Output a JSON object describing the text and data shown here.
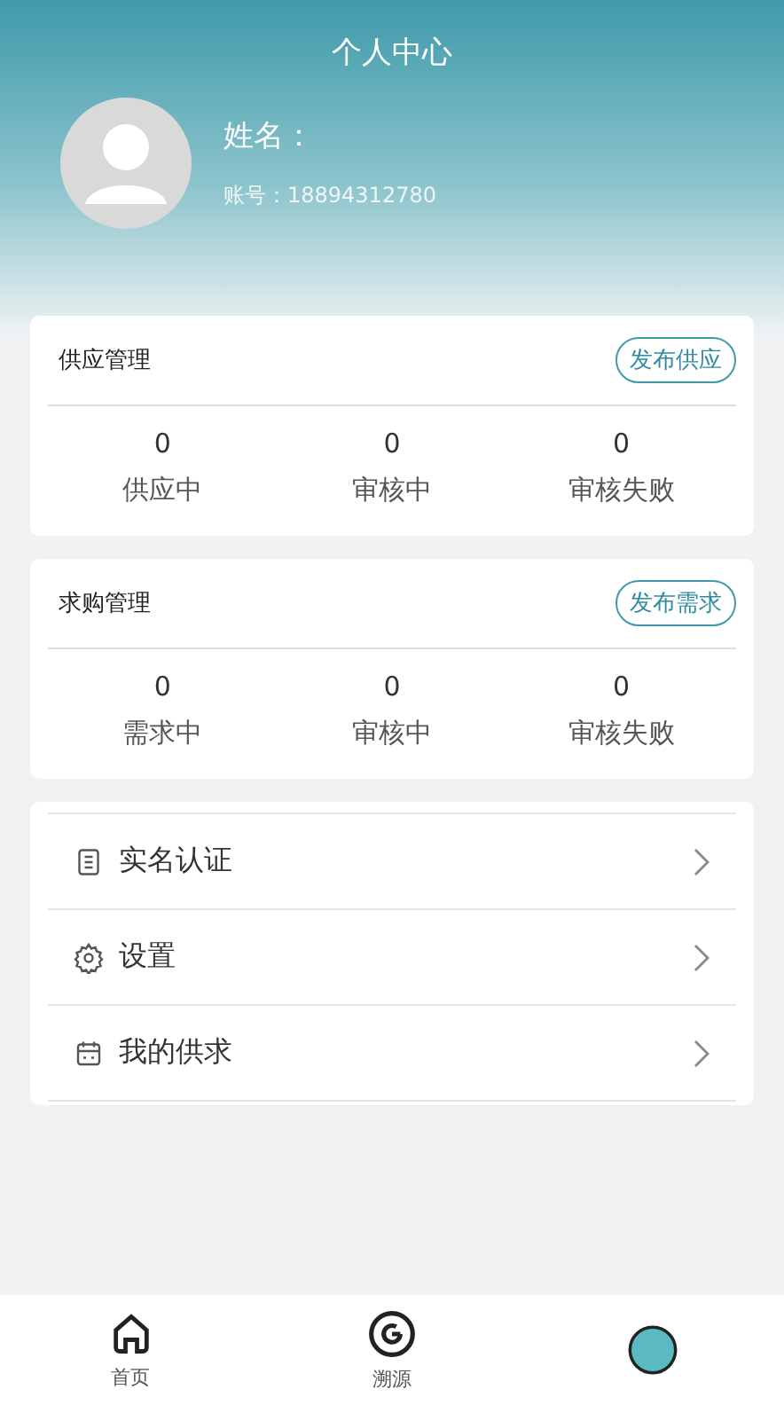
{
  "header": {
    "title": "个人中心",
    "name_label": "姓名：",
    "account": "账号：18894312780"
  },
  "sections": [
    {
      "title": "供应管理",
      "action": "发布供应",
      "stats": [
        {
          "value": "0",
          "label": "供应中"
        },
        {
          "value": "0",
          "label": "审核中"
        },
        {
          "value": "0",
          "label": "审核失败"
        }
      ]
    },
    {
      "title": "求购管理",
      "action": "发布需求",
      "stats": [
        {
          "value": "0",
          "label": "需求中"
        },
        {
          "value": "0",
          "label": "审核中"
        },
        {
          "value": "0",
          "label": "审核失败"
        }
      ]
    }
  ],
  "menu": [
    {
      "kind": "document",
      "label": "实名认证"
    },
    {
      "kind": "settings",
      "label": "设置"
    },
    {
      "kind": "calendar",
      "label": "我的供求"
    }
  ],
  "tabbar": [
    {
      "kind": "home",
      "label": "首页",
      "selected": false
    },
    {
      "kind": "trace",
      "label": "溯源",
      "selected": false
    },
    {
      "kind": "profile",
      "selected": true
    }
  ]
}
